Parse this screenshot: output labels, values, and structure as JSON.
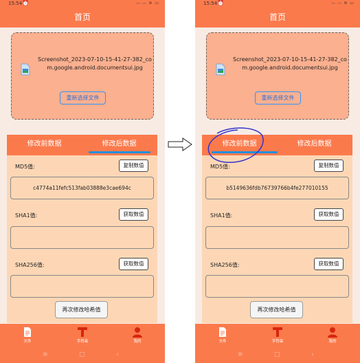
{
  "status": {
    "time": "15:54",
    "alarm_icon": "alarm-icon",
    "indicators": "ᵢₗₗ ᵢₗₗ ≋ ▭"
  },
  "header": {
    "title": "首页"
  },
  "file": {
    "name": "Screenshot_2023-07-10-15-41-27-382_com.google.android.documentsui.jpg",
    "reselect_label": "重新选择文件"
  },
  "tabs": {
    "before": "修改前数据",
    "after": "修改后数据"
  },
  "fields": {
    "md5_label": "MD5值:",
    "sha1_label": "SHA1值:",
    "sha256_label": "SHA256值:",
    "copy_label": "复制数值",
    "get_label": "获取数值",
    "rehash_label": "再次修改哈希值"
  },
  "left": {
    "md5_value": "c4774a11fefc513fab03888e3cae694c",
    "sha1_value": "",
    "sha256_value": "",
    "active_tab": "after"
  },
  "right": {
    "md5_value": "b5149636fdb76739766b4fe277010155",
    "sha1_value": "",
    "sha256_value": "",
    "active_tab": "before"
  },
  "nav": {
    "files": "文件",
    "strings": "字符串",
    "mine": "我的"
  },
  "sysnav": {
    "menu": "≡",
    "home": "□",
    "back": "‹"
  },
  "colors": {
    "accent": "#fb7a4c",
    "panel": "#fdd7b5",
    "file_box": "#fbb08f",
    "tab_indicator": "#1f8fe0",
    "annotation": "#3333cc"
  },
  "icons": [
    "file-image-icon",
    "document-icon",
    "text-t-icon",
    "person-icon",
    "arrow-right-icon"
  ]
}
